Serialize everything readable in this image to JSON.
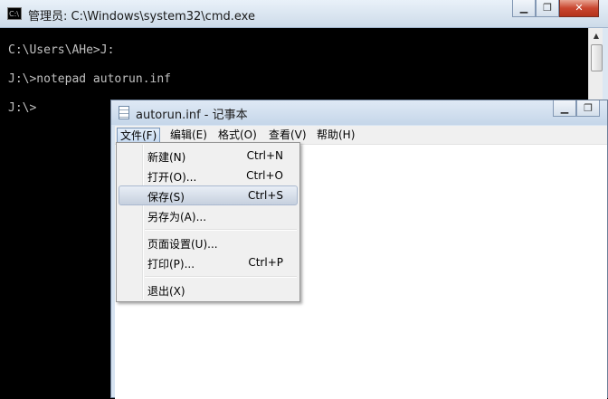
{
  "cmd": {
    "title": "管理员: C:\\Windows\\system32\\cmd.exe",
    "icon_text": "C:\\",
    "lines": [
      "C:\\Users\\AHe>J:",
      "J:\\>notepad autorun.inf",
      "J:\\>"
    ]
  },
  "notepad": {
    "title": "autorun.inf - 记事本",
    "menus": [
      "文件(F)",
      "编辑(E)",
      "格式(O)",
      "查看(V)",
      "帮助(H)"
    ],
    "active_menu": "文件(F)"
  },
  "file_menu": {
    "items": [
      {
        "label": "新建(N)",
        "shortcut": "Ctrl+N"
      },
      {
        "label": "打开(O)...",
        "shortcut": "Ctrl+O"
      },
      {
        "label": "保存(S)",
        "shortcut": "Ctrl+S",
        "highlighted": true
      },
      {
        "label": "另存为(A)...",
        "shortcut": ""
      },
      {
        "label": "页面设置(U)...",
        "shortcut": ""
      },
      {
        "label": "打印(P)...",
        "shortcut": "Ctrl+P"
      },
      {
        "label": "退出(X)",
        "shortcut": ""
      }
    ]
  },
  "colors": {
    "console_bg": "#000000",
    "console_text": "#c0c0c0",
    "close_button": "#c9462f"
  }
}
